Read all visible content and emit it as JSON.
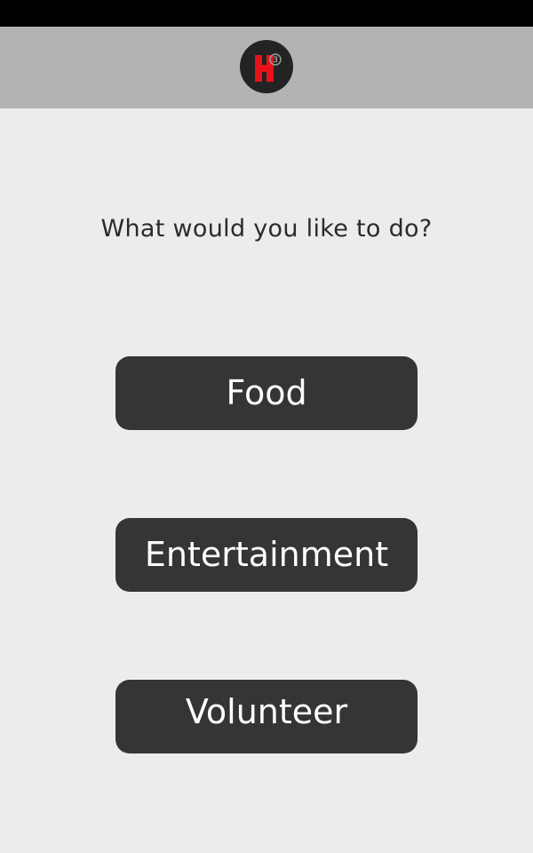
{
  "header": {
    "logo_icon": "h3-logo-icon",
    "logo_superscript": "3"
  },
  "main": {
    "prompt": "What would you like to do?",
    "options": [
      {
        "label": "Food"
      },
      {
        "label": "Entertainment"
      },
      {
        "label": "Volunteer"
      }
    ]
  },
  "colors": {
    "status_bar": "#000000",
    "header_bg": "#b3b3b3",
    "page_bg": "#ececec",
    "button_bg": "#353535",
    "button_text": "#ffffff",
    "logo_accent": "#e8121b"
  }
}
